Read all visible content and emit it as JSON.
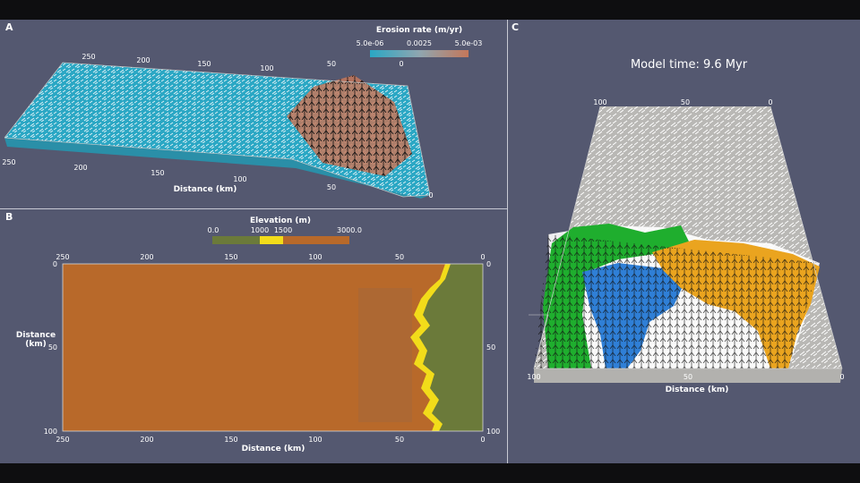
{
  "panel_a": {
    "letter": "A",
    "colorbar": {
      "title": "Erosion rate (m/yr)",
      "ticks": [
        "5.0e-06",
        "0.0025",
        "5.0e-03"
      ]
    },
    "top_ticks": [
      "250",
      "200",
      "150",
      "100",
      "50",
      "0"
    ],
    "bottom_ticks": [
      "250",
      "200",
      "150",
      "100",
      "50",
      "0"
    ],
    "xlabel": "Distance (km)"
  },
  "panel_b": {
    "letter": "B",
    "colorbar": {
      "title": "Elevation (m)",
      "ticks": [
        "0.0",
        "1000",
        "1500",
        "3000.0"
      ]
    },
    "top_ticks": [
      "250",
      "200",
      "150",
      "100",
      "50",
      "0"
    ],
    "bottom_ticks": [
      "250",
      "200",
      "150",
      "100",
      "50",
      "0"
    ],
    "left_ticks": [
      "0",
      "50",
      "100"
    ],
    "right_ticks": [
      "0",
      "50",
      "100"
    ],
    "xlabel": "Distance (km)",
    "ylabel_line1": "Distance",
    "ylabel_line2": "(km)"
  },
  "panel_c": {
    "letter": "C",
    "title": "Model time: 9.6 Myr",
    "top_ticks": [
      "100",
      "50",
      "0"
    ],
    "bottom_ticks": [
      "100",
      "50",
      "0"
    ],
    "xlabel": "Distance (km)"
  },
  "colors": {
    "background": "#545870",
    "erosion_low": "#2aa7c4",
    "erosion_high": "#c4775a",
    "elev_low": "#6b7a3a",
    "elev_mid": "#f2dc1a",
    "elev_high": "#b8692a",
    "basin_green": "#1fae2e",
    "basin_blue": "#2f7fd6",
    "basin_orange": "#eaa41f"
  }
}
